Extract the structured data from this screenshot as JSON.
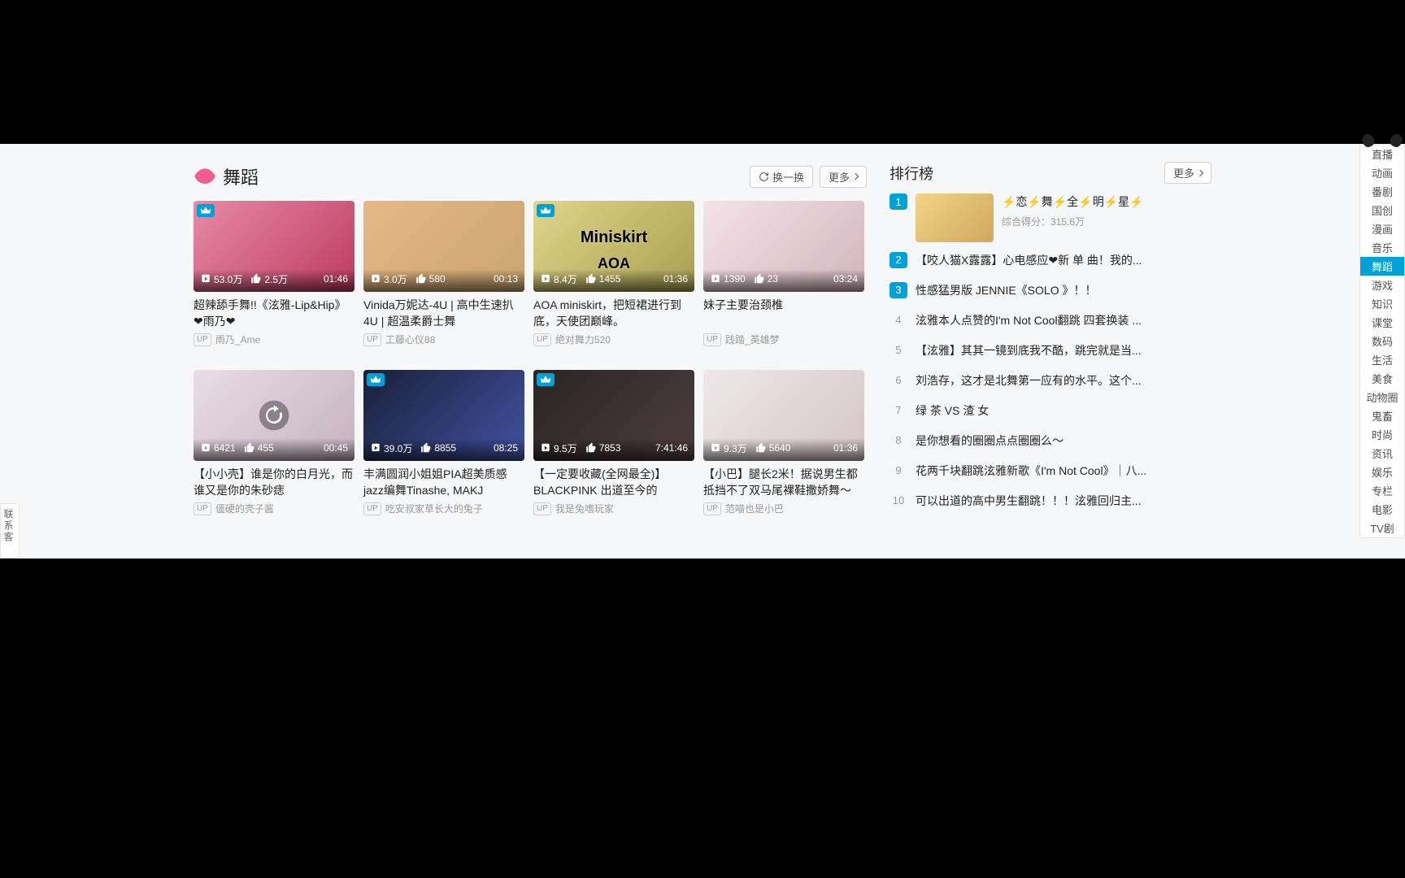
{
  "section": {
    "title": "舞蹈",
    "refresh_label": "换一换",
    "more_label": "更多"
  },
  "videos": [
    {
      "plays": "53.0万",
      "likes": "2.5万",
      "duration": "01:46",
      "title": "超辣舔手舞!!《泫雅-Lip&Hip》❤雨乃❤",
      "up": "雨乃_Ame",
      "crown": true
    },
    {
      "plays": "3.0万",
      "likes": "580",
      "duration": "00:13",
      "title": "Vinida万妮达-4U | 高中生速扒4U | 超温柔爵士舞",
      "up": "工藤心仪88",
      "crown": false
    },
    {
      "plays": "8.4万",
      "likes": "1455",
      "duration": "01:36",
      "title": "AOA miniskirt，把短裙进行到底，天使团巅峰。",
      "up": "绝对舞力520",
      "crown": true,
      "thumb_text": "Miniskirt",
      "thumb_text2": "AOA"
    },
    {
      "plays": "1390",
      "likes": "23",
      "duration": "03:24",
      "title": "妹子主要治颈椎",
      "up": "践踏_英雄梦",
      "crown": false
    },
    {
      "plays": "6421",
      "likes": "455",
      "duration": "00:45",
      "title": "【小小壳】谁是你的白月光，而谁又是你的朱砂痣",
      "up": "僵硬的壳子酱",
      "crown": false,
      "aux": true
    },
    {
      "plays": "39.0万",
      "likes": "8855",
      "duration": "08:25",
      "title": "丰满圆润小姐姐PIA超美质感jazz编舞Tinashe, MAKJ",
      "up": "吃安叔家草长大的兔子",
      "crown": true
    },
    {
      "plays": "9.5万",
      "likes": "7853",
      "duration": "7:41:46",
      "title": "【一定要收藏(全网最全)】BLACKPINK 出道至今的",
      "up": "我是兔嗜玩家",
      "crown": true
    },
    {
      "plays": "9.3万",
      "likes": "5640",
      "duration": "01:36",
      "title": "【小巴】腿长2米！据说男生都抵挡不了双马尾裸鞋撒娇舞～",
      "up": "范喵也是小巴",
      "crown": false
    }
  ],
  "ranking": {
    "title": "排行榜",
    "more_label": "更多",
    "first": {
      "title": "⚡恋⚡舞⚡全⚡明⚡星⚡",
      "score_label": "综合得分：",
      "score": "315.6万"
    },
    "items": [
      "【咬人猫X露露】心电感应❤新 单 曲！我的...",
      "性感猛男版 JENNIE《SOLO 》！！",
      "泫雅本人点赞的I'm Not Cool翻跳 四套换装 ...",
      "【泫雅】其其一镜到底我不酷，跳完就是当...",
      "刘浩存，这才是北舞第一应有的水平。这个...",
      "绿 茶 VS 渣 女",
      "是你想看的圈圈点点圈圈么～",
      "花两千块翻跳泫雅新歌《I'm Not Cool》｜八...",
      "可以出道的高中男生翻跳！！！泫雅回归主..."
    ]
  },
  "float_nav": {
    "items": [
      "直播",
      "动画",
      "番剧",
      "国创",
      "漫画",
      "音乐",
      "舞蹈",
      "游戏",
      "知识",
      "课堂",
      "数码",
      "生活",
      "美食",
      "动物圈",
      "鬼畜",
      "时尚",
      "资讯",
      "娱乐",
      "专栏",
      "电影",
      "TV剧"
    ],
    "active": "舞蹈"
  },
  "cs_float": "联系客服"
}
